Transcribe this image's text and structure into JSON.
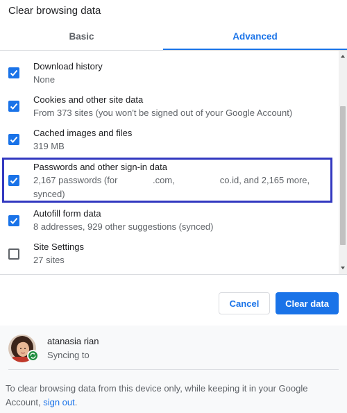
{
  "dialog": {
    "title": "Clear browsing data"
  },
  "tabs": [
    {
      "label": "Basic",
      "selected": false
    },
    {
      "label": "Advanced",
      "selected": true
    }
  ],
  "items": [
    {
      "title": "Download history",
      "subtitle": "None",
      "checked": true
    },
    {
      "title": "Cookies and other site data",
      "subtitle": "From 373 sites (you won't be signed out of your Google Account)",
      "checked": true
    },
    {
      "title": "Cached images and files",
      "subtitle": "319 MB",
      "checked": true
    },
    {
      "title": "Passwords and other sign-in data",
      "subtitle": "2,167 passwords (for              .com,                  co.id, and 2,165 more, synced)",
      "checked": true,
      "highlighted": true
    },
    {
      "title": "Autofill form data",
      "subtitle": "8 addresses, 929 other suggestions (synced)",
      "checked": true
    },
    {
      "title": "Site Settings",
      "subtitle": "27 sites",
      "checked": false
    }
  ],
  "buttons": {
    "cancel": "Cancel",
    "clear": "Clear data"
  },
  "account": {
    "name": "atanasia rian",
    "sync_status": "Syncing to"
  },
  "footer": {
    "text": "To clear browsing data from this device only, while keeping it in your Google Account,",
    "link": "sign out",
    "suffix": "."
  },
  "colors": {
    "accent": "#1a73e8",
    "highlight_border": "#3238c0",
    "sync_badge": "#1e8e3e"
  }
}
